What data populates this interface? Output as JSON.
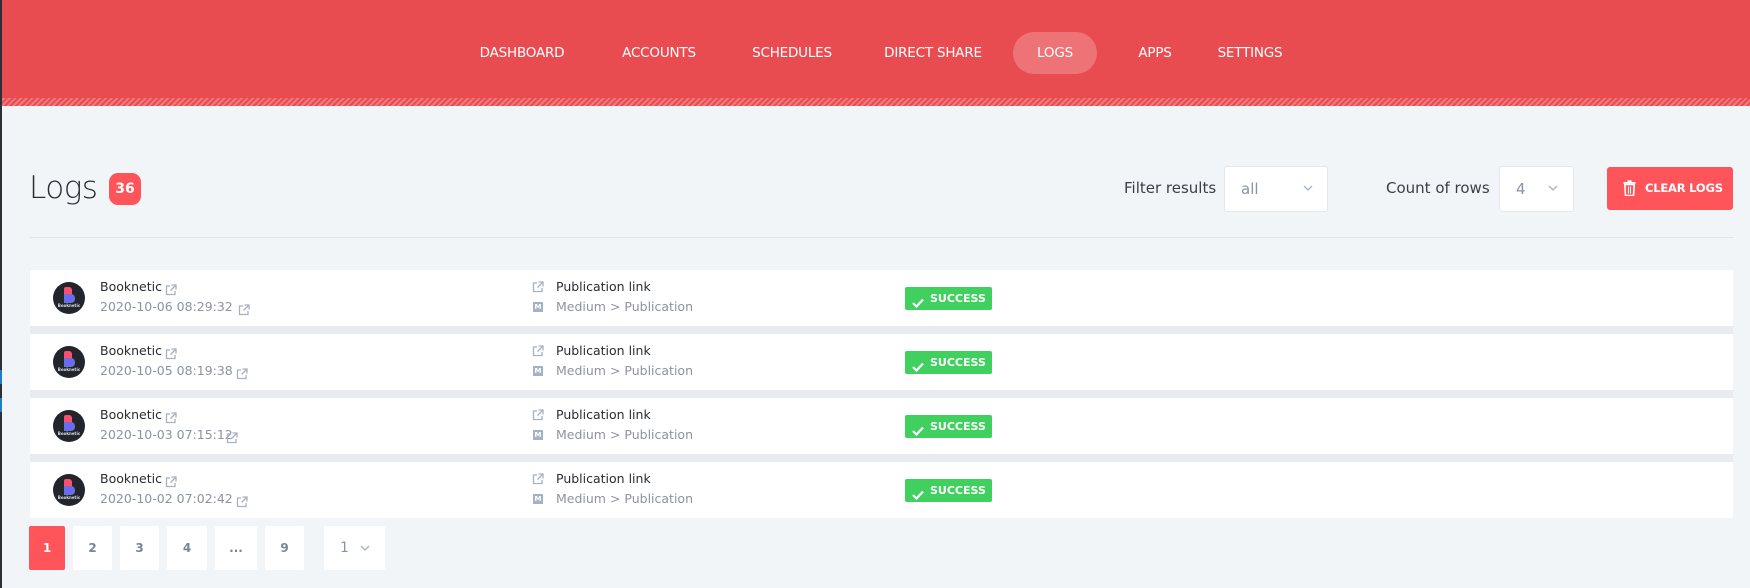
{
  "nav": {
    "items": [
      {
        "label": "DASHBOARD",
        "active": false
      },
      {
        "label": "ACCOUNTS",
        "active": false
      },
      {
        "label": "SCHEDULES",
        "active": false
      },
      {
        "label": "DIRECT SHARE",
        "active": false
      },
      {
        "label": "LOGS",
        "active": true
      },
      {
        "label": "APPS",
        "active": false
      },
      {
        "label": "SETTINGS",
        "active": false
      }
    ]
  },
  "page": {
    "title": "Logs",
    "count": "36"
  },
  "filters": {
    "filter_label": "Filter results",
    "filter_value": "all",
    "rows_label": "Count of rows",
    "rows_value": "4",
    "clear_label": "CLEAR LOGS"
  },
  "logs": [
    {
      "account": "Booknetic",
      "avatar_text": "Booknetic",
      "date": "2020-10-06 08:29:32",
      "link_label": "Publication link",
      "source_icon": "M",
      "source": "Medium > Publication",
      "status": "SUCCESS"
    },
    {
      "account": "Booknetic",
      "avatar_text": "Booknetic",
      "date": "2020-10-05 08:19:38",
      "link_label": "Publication link",
      "source_icon": "M",
      "source": "Medium > Publication",
      "status": "SUCCESS"
    },
    {
      "account": "Booknetic",
      "avatar_text": "Booknetic",
      "date": "2020-10-03 07:15:12",
      "link_label": "Publication link",
      "source_icon": "M",
      "source": "Medium > Publication",
      "status": "SUCCESS"
    },
    {
      "account": "Booknetic",
      "avatar_text": "Booknetic",
      "date": "2020-10-02 07:02:42",
      "link_label": "Publication link",
      "source_icon": "M",
      "source": "Medium > Publication",
      "status": "SUCCESS"
    }
  ],
  "pagination": {
    "pages": [
      "1",
      "2",
      "3",
      "4",
      "...",
      "9"
    ],
    "current": "1",
    "select_value": "1"
  },
  "colors": {
    "brand": "#e84c51",
    "accent": "#ff5459",
    "success": "#3fd05e",
    "background": "#f2f5f8"
  }
}
